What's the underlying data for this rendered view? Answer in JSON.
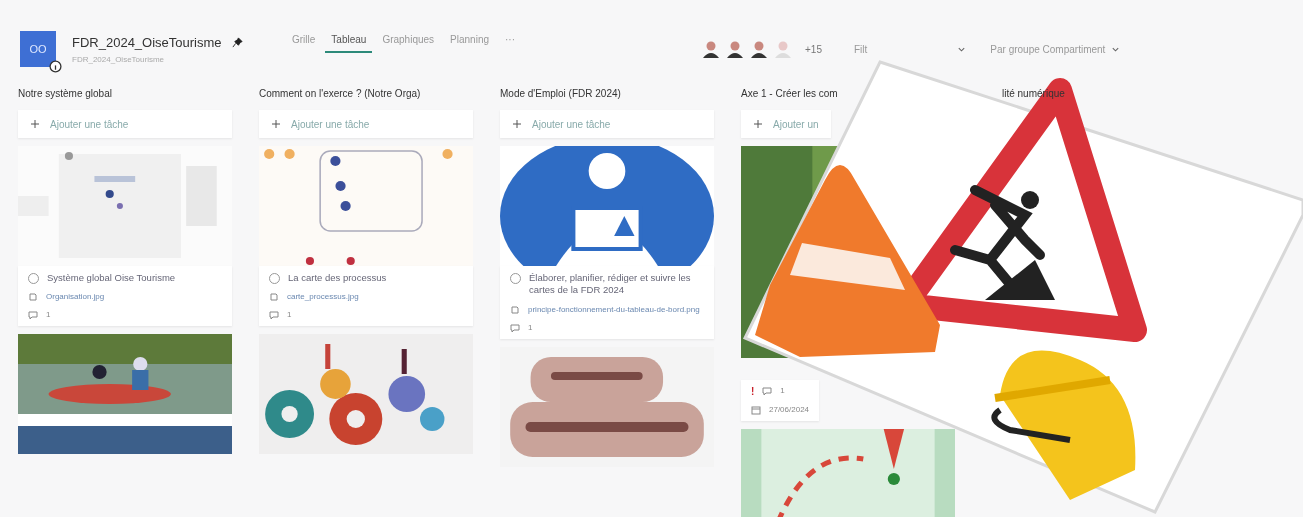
{
  "plan": {
    "logo": "OO",
    "title": "FDR_2024_OiseTourisme",
    "subtitle": "FDR_2024_OiseTourisme"
  },
  "tabs": [
    {
      "label": "Grille",
      "selected": false
    },
    {
      "label": "Tableau",
      "selected": true
    },
    {
      "label": "Graphiques",
      "selected": false
    },
    {
      "label": "Planning",
      "selected": false
    }
  ],
  "more": "···",
  "members": {
    "count": "+15"
  },
  "filter": "Filt",
  "group_by": "Par groupe Compartiment",
  "buckets": [
    {
      "title": "Notre système global",
      "add_task": "Ajouter une tâche",
      "cards": [
        {
          "kind": "picture"
        },
        {
          "kind": "task",
          "title": "Système global Oise Tourisme",
          "checked": false,
          "attachment": "Organisation.jpg",
          "comments": "1"
        },
        {
          "kind": "picture"
        }
      ]
    },
    {
      "title": "Comment on l'exerce ? (Notre Orga)",
      "add_task": "Ajouter une tâche",
      "cards": [
        {
          "kind": "picture"
        },
        {
          "kind": "task",
          "title": "La carte des processus",
          "checked": false,
          "attachment": "carte_processus.jpg",
          "comments": "1"
        },
        {
          "kind": "picture"
        }
      ]
    },
    {
      "title": "Mode d'Emploi (FDR 2024)",
      "add_task": "Ajouter une tâche",
      "cards": [
        {
          "kind": "picture"
        },
        {
          "kind": "task",
          "title": "Élaborer, planifier, rédiger et suivre les cartes de la FDR 2024",
          "checked": false,
          "attachment": "principe-fonctionnement-du-tableau-de-bord.png",
          "comments": "1"
        },
        {
          "kind": "picture"
        }
      ]
    },
    {
      "title": "Axe 1 - Créer les com",
      "add_task": "Ajouter un",
      "cards": [
        {
          "kind": "picture"
        },
        {
          "kind": "meta",
          "priority": "!",
          "comments": "1",
          "date": "27/06/2024"
        },
        {
          "kind": "picture"
        }
      ]
    },
    {
      "title": "lité numérique"
    }
  ]
}
